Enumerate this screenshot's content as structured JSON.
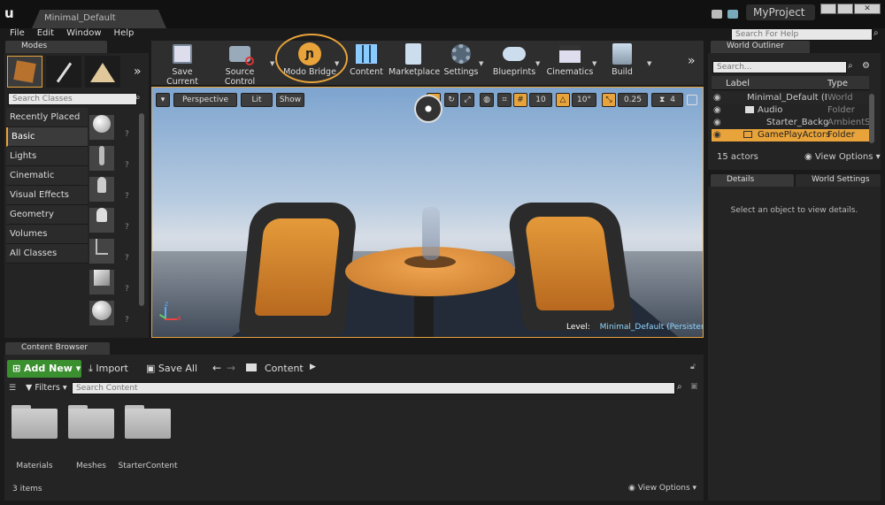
{
  "window": {
    "tab_title": "Minimal_Default",
    "project": "MyProject",
    "search_help_placeholder": "Search For Help"
  },
  "menu": [
    "File",
    "Edit",
    "Window",
    "Help"
  ],
  "modes": {
    "tab": "Modes",
    "search_placeholder": "Search Classes",
    "categories": [
      "Recently Placed",
      "Basic",
      "Lights",
      "Cinematic",
      "Visual Effects",
      "Geometry",
      "Volumes",
      "All Classes"
    ],
    "selected": "Basic"
  },
  "toolbar": {
    "buttons": [
      "Save Current",
      "Source Control",
      "Modo Bridge",
      "Content",
      "Marketplace",
      "Settings",
      "Blueprints",
      "Cinematics",
      "Build"
    ],
    "highlight": "#e8a33a"
  },
  "viewport": {
    "perspective": "Perspective",
    "lit": "Lit",
    "show": "Show",
    "grid_snap": "10",
    "rot_snap": "10°",
    "scale_snap": "0.25",
    "cam_speed": "4",
    "level_label": "Level:",
    "level_name": "Minimal_Default (Persistent)"
  },
  "outliner": {
    "tab": "World Outliner",
    "search_placeholder": "Search...",
    "col_label": "Label",
    "col_type": "Type",
    "rows": [
      {
        "label": "Minimal_Default (Ed",
        "type": "World"
      },
      {
        "label": "Audio",
        "type": "Folder"
      },
      {
        "label": "Starter_Backgro",
        "type": "AmbientSo"
      },
      {
        "label": "GamePlayActors",
        "type": "Folder"
      }
    ],
    "count": "15 actors",
    "view_options": "View Options"
  },
  "details": {
    "tab": "Details",
    "tab2": "World Settings",
    "empty": "Select an object to view details."
  },
  "content_browser": {
    "tab": "Content Browser",
    "add_new": "Add New",
    "import": "Import",
    "save_all": "Save All",
    "path": "Content",
    "filters": "Filters",
    "search_placeholder": "Search Content",
    "folders": [
      "Materials",
      "Meshes",
      "StarterContent"
    ],
    "count": "3 items",
    "view_options": "View Options"
  }
}
